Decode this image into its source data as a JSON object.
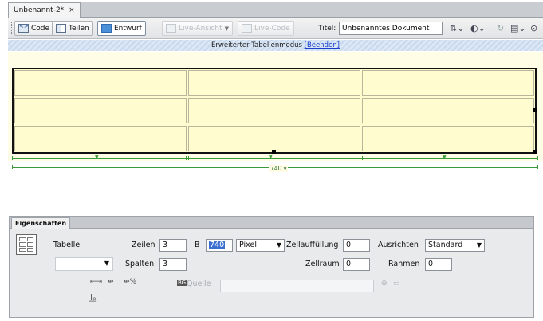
{
  "document": {
    "tab_title": "Unbenannt-2*",
    "close_glyph": "×"
  },
  "toolbar": {
    "code_label": "Code",
    "split_label": "Teilen",
    "design_label": "Entwurf",
    "live_view_label": "Live-Ansicht",
    "live_code_label": "Live-Code",
    "title_label": "Titel:",
    "title_value": "Unbenanntes Dokument",
    "icons": [
      "browser-check-icon",
      "preview-globe-icon",
      "refresh-icon",
      "view-options-icon",
      "visual-aids-icon"
    ]
  },
  "infobar": {
    "text": "Erweiterter Tabellenmodus",
    "exit_link": "[Beenden]"
  },
  "table": {
    "rows": 3,
    "cols": 3,
    "width_readout": "740"
  },
  "properties": {
    "tab_label": "Eigenschaften",
    "table_label": "Tabelle",
    "rows_label": "Zeilen",
    "rows_value": "3",
    "cols_label": "Spalten",
    "cols_value": "3",
    "width_label": "B",
    "width_value": "740",
    "unit_value": "Pixel",
    "cellpad_label": "Zellauffüllung",
    "cellpad_value": "0",
    "cellspace_label": "Zellraum",
    "cellspace_value": "0",
    "align_label": "Ausrichten",
    "align_value": "Standard",
    "border_label": "Rahmen",
    "border_value": "0",
    "source_label": "Quelle",
    "icons": [
      "clear-column-widths-icon",
      "convert-widths-to-pixels-icon",
      "convert-widths-to-percent-icon",
      "clear-row-heights-icon",
      "browse-folder-icon",
      "point-to-file-icon"
    ]
  }
}
